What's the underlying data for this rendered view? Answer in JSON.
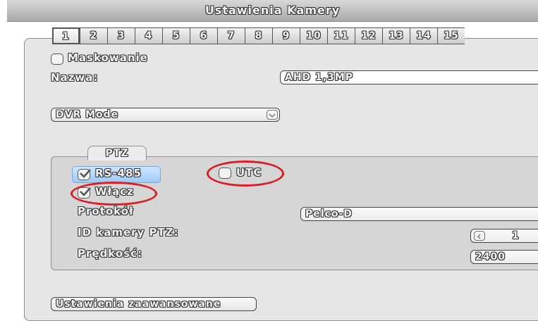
{
  "window": {
    "title": "Ustawienia Kamery"
  },
  "channel_tabs": [
    "1",
    "2",
    "3",
    "4",
    "5",
    "6",
    "7",
    "8",
    "9",
    "10",
    "11",
    "12",
    "13",
    "14",
    "15"
  ],
  "masking": {
    "label": "Maskowanie",
    "checked": false
  },
  "name": {
    "label": "Nazwa:",
    "value": "AHD 1,3MP"
  },
  "mode_select": {
    "value": "DVR Mode"
  },
  "ptz": {
    "tab_label": "PTZ",
    "rs485": {
      "label": "RS-485",
      "checked": true
    },
    "utc": {
      "label": "UTC",
      "checked": false
    },
    "enable": {
      "label": "Włącz",
      "checked": true
    },
    "protocol": {
      "label": "Protokół",
      "value": "Pelco-D"
    },
    "camera_id": {
      "label": "ID kamery PTZ:",
      "value": "1"
    },
    "speed": {
      "label": "Prędkość:",
      "value": "2400"
    }
  },
  "advanced_button": {
    "label": "Ustawienia zaawansowane"
  },
  "colors": {
    "annotation": "#d81f26",
    "highlight": "#9ec9f5",
    "panel": "#e6e6e6"
  }
}
